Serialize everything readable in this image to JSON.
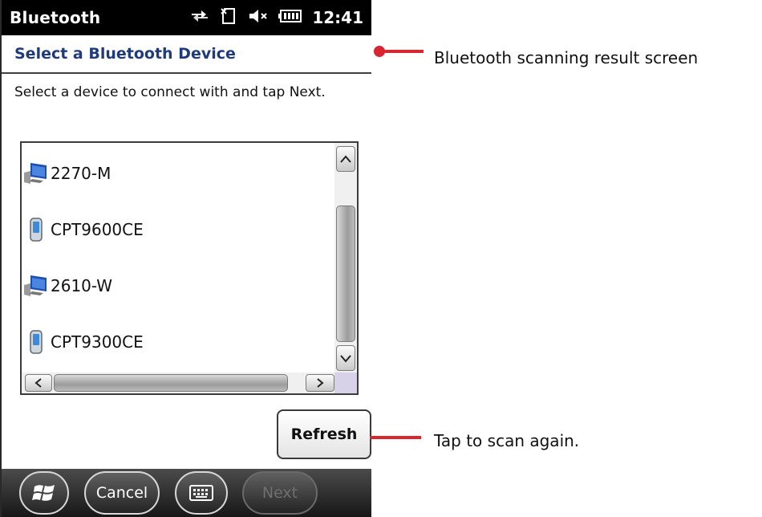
{
  "status_bar": {
    "app_title": "Bluetooth",
    "clock": "12:41",
    "icons": [
      "connectivity-icon",
      "sim-icon",
      "speaker-muted-icon",
      "battery-icon"
    ]
  },
  "title": "Select a Bluetooth Device",
  "instruction": "Select a device to connect with and tap Next.",
  "devices": [
    {
      "name": "2270-M",
      "icon": "computer-icon"
    },
    {
      "name": "CPT9600CE",
      "icon": "handheld-device-icon"
    },
    {
      "name": "2610-W",
      "icon": "computer-icon"
    },
    {
      "name": "CPT9300CE",
      "icon": "handheld-device-icon"
    }
  ],
  "refresh_label": "Refresh",
  "taskbar": {
    "start_icon": "windows-logo-icon",
    "cancel_label": "Cancel",
    "keyboard_icon": "keyboard-icon",
    "next_label": "Next"
  },
  "callouts": {
    "screen": "Bluetooth scanning result screen",
    "refresh": "Tap to scan again."
  },
  "colors": {
    "title_text": "#1f3a7d",
    "callout": "#d72630",
    "status_bar": "#000000"
  }
}
